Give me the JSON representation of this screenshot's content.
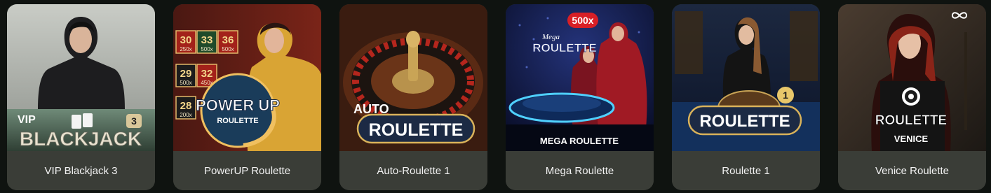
{
  "games": [
    {
      "title": "VIP Blackjack 3",
      "logo_line1": "VIP",
      "logo_line2": "BLACKJACK",
      "badge": "3"
    },
    {
      "title": "PowerUP Roulette",
      "logo_line1": "POWER UP",
      "logo_line2": "ROULETTE",
      "board_numbers": [
        "30",
        "33",
        "36",
        "29",
        "32",
        "28"
      ],
      "board_multipliers": [
        "250x",
        "500x",
        "500x",
        "500x",
        "450x",
        "200x"
      ]
    },
    {
      "title": "Auto-Roulette 1",
      "logo_line1": "AUTO",
      "logo_line2": "ROULETTE"
    },
    {
      "title": "Mega Roulette",
      "badge": "500x",
      "logo_line1": "Mega",
      "logo_line2": "ROULETTE",
      "footer_text": "MEGA ROULETTE"
    },
    {
      "title": "Roulette 1",
      "logo_line1": "ROULETTE",
      "badge": "1"
    },
    {
      "title": "Venice Roulette",
      "logo_line1": "ROULETTE",
      "logo_line2": "VENICE"
    }
  ],
  "colors": {
    "page_bg": "#0f1310",
    "card_caption_bg": "#3a3d37",
    "caption_text": "#f2f2f2",
    "gold": "#d9b25a"
  }
}
